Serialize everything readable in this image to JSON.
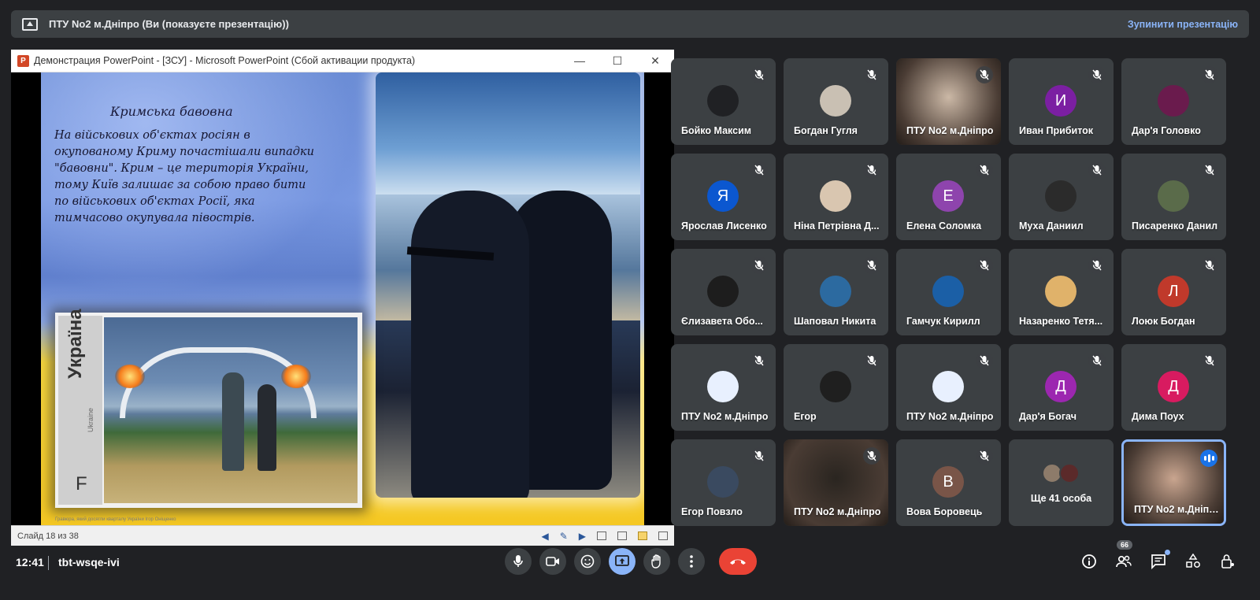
{
  "banner": {
    "title": "ПТУ No2 м.Дніпро (Ви (показуєте презентацію))",
    "stop_label": "Зупинити презентацію"
  },
  "ppt": {
    "window_title": "Демонстрация PowerPoint - [ЗСУ] - Microsoft PowerPoint (Сбой активации продукта)",
    "logo_letter": "P",
    "slide": {
      "heading": "Кримська бавовна",
      "body": "На військових об'єктах росіян в окупованому Криму почастішали випадки \"бавовни\". Крим – це територія України, тому Київ залишає за собою право бити по військових об'єктах Росії, яка тимчасово окупувала півострів.",
      "stamp_country": "Україна",
      "stamp_country_en": "Ukraine",
      "stamp_letter": "F",
      "caption": "Гравюра, який досягли кварталу України Ігор Оніщенко"
    },
    "status_slide": "Слайд 18 из 38"
  },
  "participants": [
    {
      "name": "Бойко Максим",
      "type": "avatar",
      "color": "#202124",
      "letter": ""
    },
    {
      "name": "Богдан Гугля",
      "type": "avatar",
      "color": "#c9c0b3",
      "letter": ""
    },
    {
      "name": "ПТУ No2 м.Дніпро",
      "type": "video",
      "color": "#cbb8a6"
    },
    {
      "name": "Иван Прибиток",
      "type": "avatar",
      "color": "#7b1fa2",
      "letter": "И"
    },
    {
      "name": "Дар'я Головко",
      "type": "avatar",
      "color": "#6a1b4d",
      "letter": ""
    },
    {
      "name": "Ярослав Лисенко",
      "type": "avatar",
      "color": "#0b57d0",
      "letter": "Я"
    },
    {
      "name": "Ніна Петрівна Д...",
      "type": "avatar",
      "color": "#d9c6b0",
      "letter": ""
    },
    {
      "name": "Елена Соломка",
      "type": "avatar",
      "color": "#8e44ad",
      "letter": "Е"
    },
    {
      "name": "Муха Даниил",
      "type": "avatar",
      "color": "#2b2b2b",
      "letter": ""
    },
    {
      "name": "Писаренко Данил",
      "type": "avatar",
      "color": "#5a6b4a",
      "letter": ""
    },
    {
      "name": "Єлизавета Обо...",
      "type": "avatar",
      "color": "#1d1d1d",
      "letter": ""
    },
    {
      "name": "Шаповал Никита",
      "type": "avatar",
      "color": "#2c6aa0",
      "letter": ""
    },
    {
      "name": "Гамчук Кирилл",
      "type": "avatar",
      "color": "#1b5fa6",
      "letter": ""
    },
    {
      "name": "Назаренко Тетя...",
      "type": "avatar",
      "color": "#e0b26a",
      "letter": ""
    },
    {
      "name": "Лоюк Богдан",
      "type": "avatar",
      "color": "#c0392b",
      "letter": "Л"
    },
    {
      "name": "ПТУ No2 м.Дніпро",
      "type": "avatar",
      "color": "#e8f0fe",
      "letter": ""
    },
    {
      "name": "Егор",
      "type": "avatar",
      "color": "#1f1f1f",
      "letter": ""
    },
    {
      "name": "ПТУ No2 м.Дніпро",
      "type": "avatar",
      "color": "#e8f0fe",
      "letter": ""
    },
    {
      "name": "Дар'я Богач",
      "type": "avatar",
      "color": "#9c27b0",
      "letter": "Д"
    },
    {
      "name": "Дима Поух",
      "type": "avatar",
      "color": "#d81b60",
      "letter": "Д"
    },
    {
      "name": "Егор Повзло",
      "type": "avatar",
      "color": "#3a4a60",
      "letter": ""
    },
    {
      "name": "ПТУ No2 м.Дніпро",
      "type": "video",
      "color": "#2a2520"
    },
    {
      "name": "Вова Боровець",
      "type": "avatar",
      "color": "#795548",
      "letter": "В"
    },
    {
      "name": "Ще 41 особа",
      "type": "more",
      "color": "#3c4043"
    },
    {
      "name": "ПТУ No2 м.Дніпро",
      "type": "video",
      "color": "#c9a58f"
    }
  ],
  "bottom": {
    "time": "12:41",
    "meeting_code": "tbt-wsqe-ivi",
    "participants_count": "66"
  },
  "colors": {
    "background": "#202124",
    "tile": "#3c4043",
    "accent": "#8ab4f8",
    "end_call": "#ea4335"
  }
}
